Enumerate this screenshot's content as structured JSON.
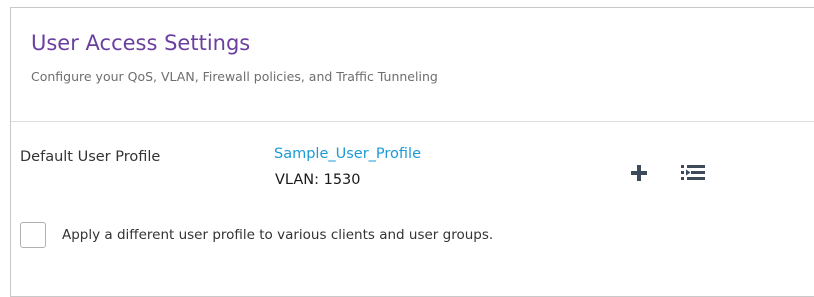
{
  "section": {
    "title": "User Access Settings",
    "subtitle": "Configure your QoS, VLAN, Firewall policies, and Traffic Tunneling"
  },
  "default_profile": {
    "label": "Default User Profile",
    "name": "Sample_User_Profile",
    "vlan": "VLAN: 1530",
    "add_icon": "plus-icon",
    "list_icon": "playlist-icon"
  },
  "apply_different": {
    "checked": false,
    "label": "Apply a different user profile to various clients and user groups."
  },
  "colors": {
    "title": "#6b3fa0",
    "link": "#1a9bd7",
    "icon": "#3c4a5a"
  }
}
